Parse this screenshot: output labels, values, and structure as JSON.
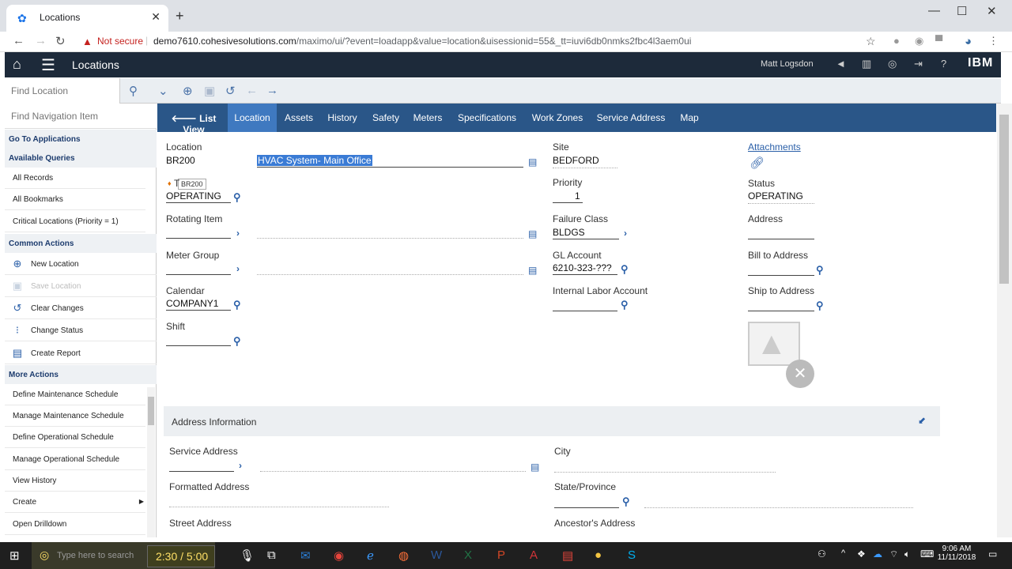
{
  "browser": {
    "tab_title": "Locations",
    "not_secure": "Not secure",
    "url_host": "demo7610.cohesivesolutions.com",
    "url_path": "/maximo/ui/?event=loadapp&value=location&uisessionid=55&_tt=iuvi6db0nmks2fbc4l3aem0ui"
  },
  "header": {
    "app_title": "Locations",
    "user": "Matt Logsdon",
    "brand": "IBM"
  },
  "toolbar": {
    "find_placeholder": "Find Location"
  },
  "sidebar": {
    "find_nav_placeholder": "Find Navigation Item",
    "go_to_apps": "Go To Applications",
    "available_queries": "Available Queries",
    "queries": [
      "All Records",
      "All Bookmarks",
      "Critical Locations (Priority = 1)"
    ],
    "common_actions": "Common Actions",
    "actions": [
      "New Location",
      "Save Location",
      "Clear Changes",
      "Change Status",
      "Create Report"
    ],
    "more_actions": "More Actions",
    "more": [
      "Define Maintenance Schedule",
      "Manage Maintenance Schedule",
      "Define Operational Schedule",
      "Manage Operational Schedule",
      "View History",
      "Create",
      "Open Drilldown"
    ]
  },
  "tabs": {
    "list_view": "List View",
    "items": [
      "Location",
      "Assets",
      "History",
      "Safety",
      "Meters",
      "Specifications",
      "Work Zones",
      "Service Address",
      "Map"
    ]
  },
  "form": {
    "location_label": "Location",
    "location_value": "BR200",
    "description_value": "HVAC System- Main Office",
    "tooltip": "BR200",
    "type_label": "T",
    "type_value": "OPERATING",
    "rotating_item_label": "Rotating Item",
    "meter_group_label": "Meter Group",
    "calendar_label": "Calendar",
    "calendar_value": "COMPANY1",
    "shift_label": "Shift",
    "site_label": "Site",
    "site_value": "BEDFORD",
    "priority_label": "Priority",
    "priority_value": "1",
    "failure_class_label": "Failure Class",
    "failure_class_value": "BLDGS",
    "gl_account_label": "GL Account",
    "gl_account_value": "6210-323-???",
    "internal_labor_label": "Internal Labor Account",
    "attachments_label": "Attachments",
    "status_label": "Status",
    "status_value": "OPERATING",
    "address_label": "Address",
    "bill_to_label": "Bill to Address",
    "ship_to_label": "Ship to Address"
  },
  "address_section": {
    "title": "Address Information",
    "service_address": "Service Address",
    "formatted_address": "Formatted Address",
    "street_address": "Street Address",
    "city": "City",
    "state": "State/Province",
    "ancestor": "Ancestor's Address"
  },
  "taskbar": {
    "search_placeholder": "Type here to search",
    "video_time": "2:30 / 5:00",
    "time": "9:06 AM",
    "date": "11/11/2018"
  }
}
